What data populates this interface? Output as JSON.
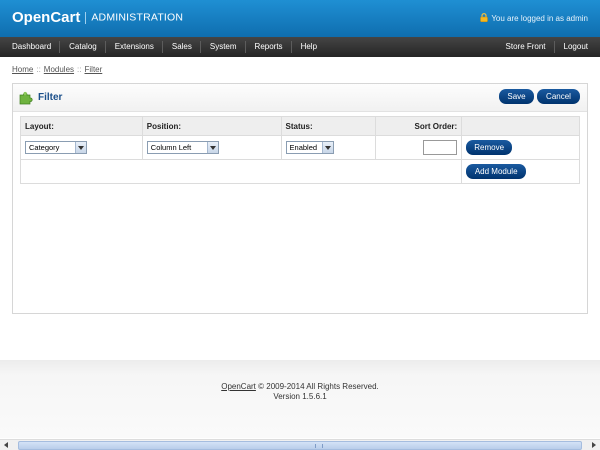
{
  "header": {
    "brand": "OpenCart",
    "subtitle": "ADMINISTRATION",
    "login_text": "You are logged in as admin",
    "lock_icon": "lock-icon"
  },
  "menu": {
    "left": [
      "Dashboard",
      "Catalog",
      "Extensions",
      "Sales",
      "System",
      "Reports",
      "Help"
    ],
    "right": [
      "Store Front",
      "Logout"
    ]
  },
  "breadcrumb": {
    "items": [
      "Home",
      "Modules",
      "Filter"
    ],
    "separator": "::"
  },
  "box": {
    "title": "Filter",
    "icon": "module-puzzle-icon",
    "save_label": "Save",
    "cancel_label": "Cancel"
  },
  "table": {
    "headers": {
      "layout": "Layout:",
      "position": "Position:",
      "status": "Status:",
      "sort_order": "Sort Order:"
    },
    "row": {
      "layout": "Category",
      "position": "Column Left",
      "status": "Enabled",
      "sort_order": ""
    },
    "remove_label": "Remove",
    "add_module_label": "Add Module"
  },
  "footer": {
    "link": "OpenCart",
    "copyright": "© 2009-2014 All Rights Reserved.",
    "version": "Version 1.5.6.1"
  },
  "colors": {
    "header_blue": "#1478be",
    "button_blue": "#0a4a8c",
    "title_blue": "#1b4f8a"
  }
}
